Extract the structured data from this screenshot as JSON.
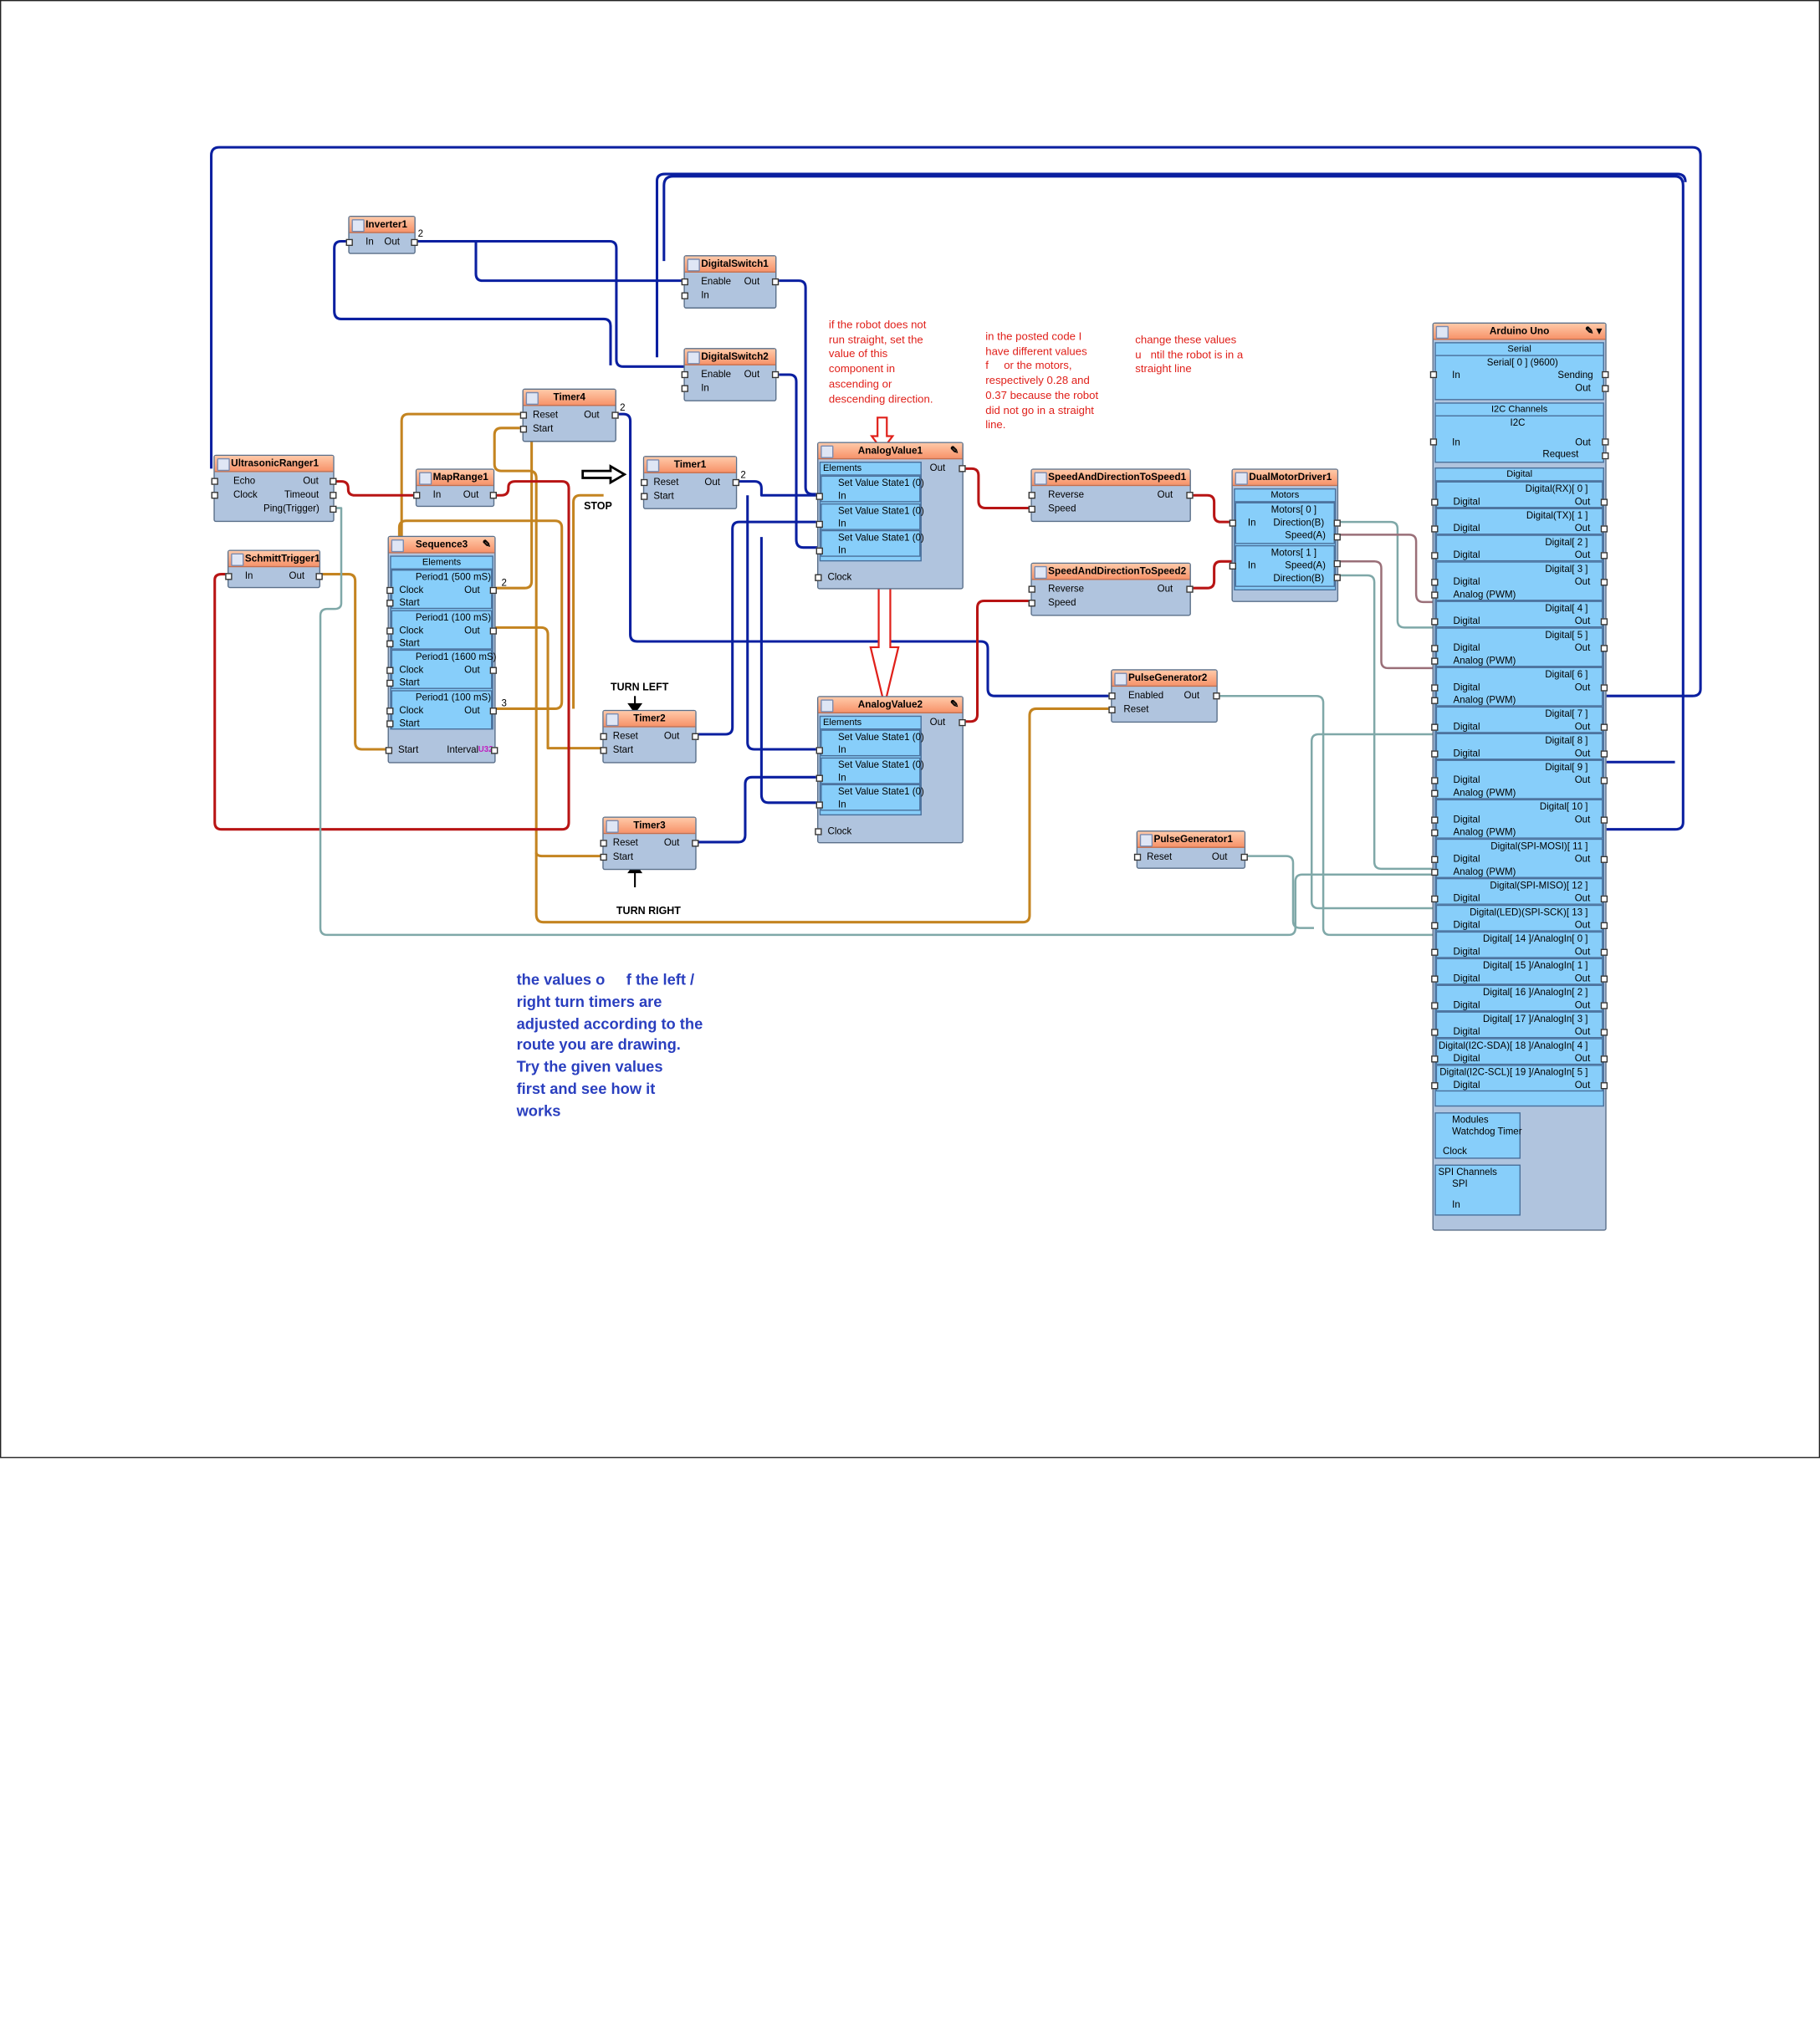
{
  "colors": {
    "wire_blue": "#0a1fa0",
    "wire_orange": "#c48420",
    "wire_red": "#b81414",
    "wire_teal": "#7fa8a8",
    "wire_mauve": "#9a6f78",
    "node_body": "#b0c4de",
    "node_header": "#f7936a",
    "sub_body": "#87cefa",
    "note_red": "#e0201a",
    "note_blue": "#2a3fbf"
  },
  "nodes": {
    "inverter1": {
      "title": "Inverter1",
      "in": "In",
      "out": "Out",
      "badge": "2"
    },
    "digitalswitch1": {
      "title": "DigitalSwitch1",
      "enable": "Enable",
      "in": "In",
      "out": "Out"
    },
    "digitalswitch2": {
      "title": "DigitalSwitch2",
      "enable": "Enable",
      "in": "In",
      "out": "Out"
    },
    "timer4": {
      "title": "Timer4",
      "reset": "Reset",
      "start": "Start",
      "out": "Out",
      "badge": "2"
    },
    "timer1": {
      "title": "Timer1",
      "reset": "Reset",
      "start": "Start",
      "out": "Out",
      "badge": "2"
    },
    "timer2": {
      "title": "Timer2",
      "reset": "Reset",
      "start": "Start",
      "out": "Out"
    },
    "timer3": {
      "title": "Timer3",
      "reset": "Reset",
      "start": "Start",
      "out": "Out"
    },
    "ultrasonic": {
      "title": "UltrasonicRanger1",
      "echo": "Echo",
      "clock": "Clock",
      "out": "Out",
      "timeout": "Timeout",
      "ping": "Ping(Trigger)"
    },
    "maprange": {
      "title": "MapRange1",
      "in": "In",
      "out": "Out"
    },
    "schmitt": {
      "title": "SchmittTrigger1",
      "in": "In",
      "out": "Out"
    },
    "sequence": {
      "title": "Sequence3",
      "elements": "Elements",
      "periods": [
        {
          "name": "Period1 (500 mS)",
          "clock": "Clock",
          "out": "Out",
          "start": "Start",
          "badge": "2"
        },
        {
          "name": "Period1 (100 mS)",
          "clock": "Clock",
          "out": "Out",
          "start": "Start",
          "badge": ""
        },
        {
          "name": "Period1 (1600 mS)",
          "clock": "Clock",
          "out": "Out",
          "start": "Start",
          "badge": ""
        },
        {
          "name": "Period1 (100 mS)",
          "clock": "Clock",
          "out": "Out",
          "start": "Start",
          "badge": "3"
        }
      ],
      "start": "Start",
      "interval": "Interval",
      "interval_tag": "U32"
    },
    "analog1": {
      "title": "AnalogValue1",
      "elements": "Elements",
      "states": [
        "Set Value State1 (0)",
        "Set Value State1 (0)",
        "Set Value State1 (0)"
      ],
      "in": "In",
      "clock": "Clock",
      "out": "Out"
    },
    "analog2": {
      "title": "AnalogValue2",
      "elements": "Elements",
      "states": [
        "Set Value State1 (0)",
        "Set Value State1 (0)",
        "Set Value State1 (0)"
      ],
      "in": "In",
      "clock": "Clock",
      "out": "Out"
    },
    "speed1": {
      "title": "SpeedAndDirectionToSpeed1",
      "reverse": "Reverse",
      "speed": "Speed",
      "out": "Out"
    },
    "speed2": {
      "title": "SpeedAndDirectionToSpeed2",
      "reverse": "Reverse",
      "speed": "Speed",
      "out": "Out"
    },
    "motor": {
      "title": "DualMotorDriver1",
      "motors": "Motors",
      "m0": "Motors[ 0 ]",
      "m1": "Motors[ 1 ]",
      "in": "In",
      "direction": "Direction(B)",
      "speed": "Speed(A)"
    },
    "pulse2": {
      "title": "PulseGenerator2",
      "enabled": "Enabled",
      "reset": "Reset",
      "out": "Out"
    },
    "pulse1": {
      "title": "PulseGenerator1",
      "reset": "Reset",
      "out": "Out"
    }
  },
  "arduino": {
    "title": "Arduino Uno",
    "serial": {
      "title": "Serial",
      "sub": "Serial[ 0 ] (9600)",
      "in": "In",
      "sending": "Sending",
      "out": "Out"
    },
    "i2c": {
      "title": "I2C Channels",
      "sub": "I2C",
      "in": "In",
      "out": "Out",
      "request": "Request"
    },
    "digital_title": "Digital",
    "pins": [
      {
        "name": "Digital(RX)[ 0 ]",
        "a": "Digital",
        "b": "",
        "out": "Out"
      },
      {
        "name": "Digital(TX)[ 1 ]",
        "a": "Digital",
        "b": "",
        "out": "Out"
      },
      {
        "name": "Digital[ 2 ]",
        "a": "Digital",
        "b": "",
        "out": "Out"
      },
      {
        "name": "Digital[ 3 ]",
        "a": "Digital",
        "b": "Analog (PWM)",
        "out": "Out"
      },
      {
        "name": "Digital[ 4 ]",
        "a": "Digital",
        "b": "",
        "out": "Out"
      },
      {
        "name": "Digital[ 5 ]",
        "a": "Digital",
        "b": "Analog (PWM)",
        "out": "Out"
      },
      {
        "name": "Digital[ 6 ]",
        "a": "Digital",
        "b": "Analog (PWM)",
        "out": "Out"
      },
      {
        "name": "Digital[ 7 ]",
        "a": "Digital",
        "b": "",
        "out": "Out"
      },
      {
        "name": "Digital[ 8 ]",
        "a": "Digital",
        "b": "",
        "out": "Out"
      },
      {
        "name": "Digital[ 9 ]",
        "a": "Digital",
        "b": "Analog (PWM)",
        "out": "Out"
      },
      {
        "name": "Digital[ 10 ]",
        "a": "Digital",
        "b": "Analog (PWM)",
        "out": "Out"
      },
      {
        "name": "Digital(SPI-MOSI)[ 11 ]",
        "a": "Digital",
        "b": "Analog (PWM)",
        "out": "Out"
      },
      {
        "name": "Digital(SPI-MISO)[ 12 ]",
        "a": "Digital",
        "b": "",
        "out": "Out"
      },
      {
        "name": "Digital(LED)(SPI-SCK)[ 13 ]",
        "a": "Digital",
        "b": "",
        "out": "Out"
      },
      {
        "name": "Digital[ 14 ]/AnalogIn[ 0 ]",
        "a": "Digital",
        "b": "",
        "out": "Out"
      },
      {
        "name": "Digital[ 15 ]/AnalogIn[ 1 ]",
        "a": "Digital",
        "b": "",
        "out": "Out"
      },
      {
        "name": "Digital[ 16 ]/AnalogIn[ 2 ]",
        "a": "Digital",
        "b": "",
        "out": "Out"
      },
      {
        "name": "Digital[ 17 ]/AnalogIn[ 3 ]",
        "a": "Digital",
        "b": "",
        "out": "Out"
      },
      {
        "name": "Digital(I2C-SDA)[ 18 ]/AnalogIn[ 4 ]",
        "a": "Digital",
        "b": "",
        "out": "Out"
      },
      {
        "name": "Digital(I2C-SCL)[ 19 ]/AnalogIn[ 5 ]",
        "a": "Digital",
        "b": "",
        "out": "Out"
      }
    ],
    "modules": {
      "title": "Modules",
      "wd": "Watchdog Timer",
      "clock": "Clock"
    },
    "spi": {
      "title": "SPI Channels",
      "sub": "SPI",
      "in": "In",
      "tag": "SPI"
    }
  },
  "labels": {
    "stop": "STOP",
    "turn_left": "TURN LEFT",
    "turn_right": "TURN RIGHT"
  },
  "notes": {
    "analog_note": "if the robot does not\nrun straight, set the\nvalue of this\ncomponent in\nascending or\ndescending direction.",
    "code_note": "in the posted code I\nhave different values\nf     or the motors,\nrespectively 0.28 and\n0.37 because the robot\ndid not go in a straight\nline.",
    "change_note": "change these values\nu   ntil the robot is in a\nstraight line",
    "timer_note": "the values o     f the left /\nright turn timers are\nadjusted according to the\nroute you are drawing.\nTry the given values\nfirst and see how it\nworks"
  }
}
